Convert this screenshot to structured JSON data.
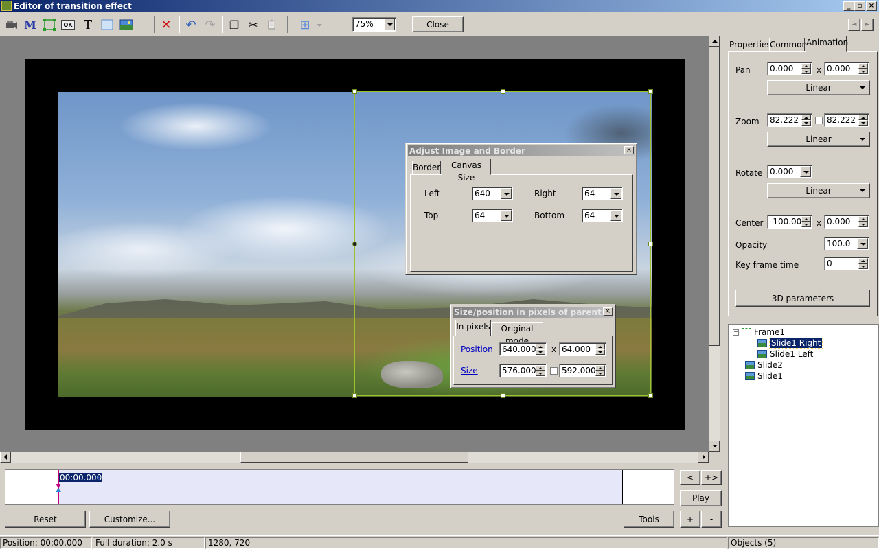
{
  "window": {
    "title": "Editor of transition effect",
    "min": "_",
    "max": "▫",
    "close": "×"
  },
  "toolbar": {
    "zoom_value": "75%",
    "close_label": "Close",
    "m_glyph": "M",
    "t_glyph": "T",
    "ok_glyph": "OK",
    "delete_glyph": "✕",
    "undo_glyph": "↶",
    "redo_glyph": "↷",
    "copy_glyph": "❐",
    "cut_glyph": "✂",
    "paste_glyph": "📋",
    "grid_glyph": "⊞",
    "nav_left": "◄",
    "nav_right": "►"
  },
  "adjust_dialog": {
    "title": "Adjust Image and Border",
    "tabs": [
      "Border",
      "Canvas Size"
    ],
    "left_label": "Left",
    "left_value": "640",
    "right_label": "Right",
    "right_value": "64",
    "top_label": "Top",
    "top_value": "64",
    "bottom_label": "Bottom",
    "bottom_value": "64"
  },
  "size_dialog": {
    "title": "Size/position in pixels of parent",
    "tabs": [
      "In pixels",
      "Original mode"
    ],
    "position_label": "Position",
    "position_x": "640.000",
    "position_y": "64.000",
    "size_label": "Size",
    "size_w": "576.000",
    "size_h": "592.000",
    "x_sep": "x"
  },
  "right_panel": {
    "tabs": [
      "Properties",
      "Common",
      "Animation"
    ],
    "pan_label": "Pan",
    "pan_x": "0.000",
    "pan_y": "0.000",
    "pan_mode": "Linear",
    "zoom_label": "Zoom",
    "zoom_x": "82.222",
    "zoom_y": "82.222",
    "zoom_mode": "Linear",
    "rotate_label": "Rotate",
    "rotate_value": "0.000",
    "rotate_mode": "Linear",
    "center_label": "Center",
    "center_x": "-100.000",
    "center_y": "0.000",
    "opacity_label": "Opacity",
    "opacity_value": "100.0",
    "keyframe_label": "Key frame time",
    "keyframe_value": "0",
    "params_button": "3D parameters",
    "x_sep": "x"
  },
  "tree": {
    "items": [
      {
        "label": "Frame1"
      },
      {
        "label": "Slide1 Right"
      },
      {
        "label": "Slide1 Left"
      },
      {
        "label": "Slide2"
      },
      {
        "label": "Slide1"
      }
    ],
    "expand_glyph": "−"
  },
  "timeline": {
    "time": "00:00.000",
    "plus_marker": "+"
  },
  "controls": {
    "prev": "<",
    "next": "+>",
    "play": "Play",
    "reset": "Reset",
    "customize": "Customize...",
    "tools": "Tools",
    "add": "+",
    "remove": "-"
  },
  "status": {
    "position": "Position:  00:00.000",
    "duration": "Full duration:  2.0 s",
    "resolution": "1280, 720",
    "objects": "Objects (5)"
  }
}
